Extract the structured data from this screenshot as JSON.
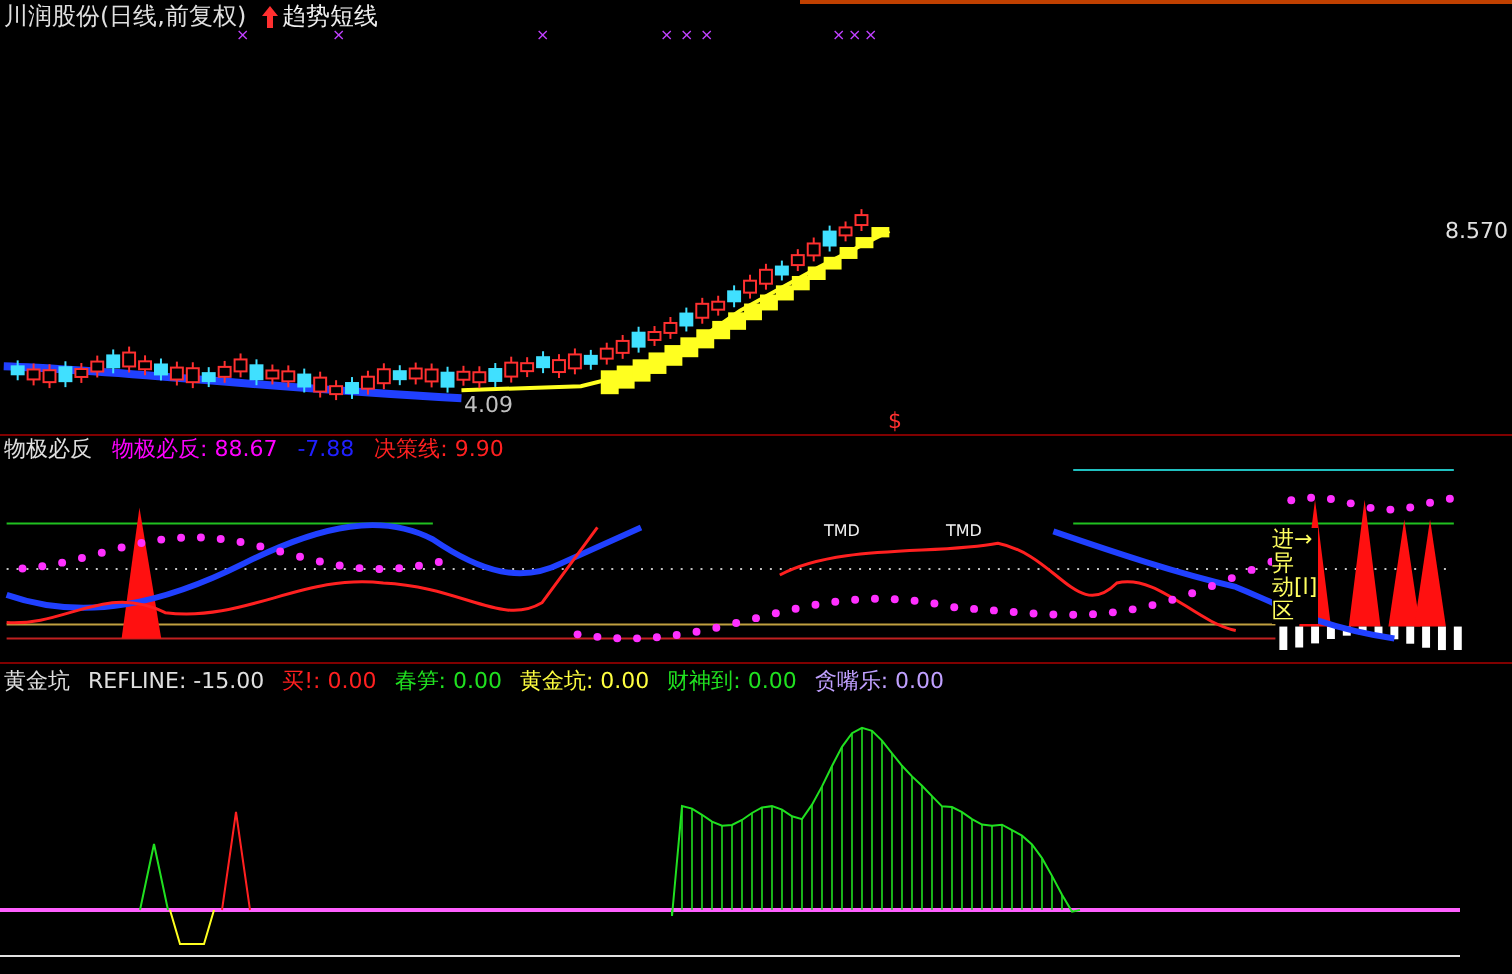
{
  "title": "川润股份(日线,前复权)",
  "indicator": "趋势短线",
  "price_labels": [
    {
      "kind": "low",
      "text": "4.09"
    },
    {
      "kind": "high",
      "text": "8.570"
    }
  ],
  "signal_mark": "$",
  "markers": [
    "×",
    "×",
    "×",
    "×",
    "×",
    "×",
    "×",
    "×",
    "×"
  ],
  "panel_2": {
    "name": "物极必反",
    "values": [
      {
        "label": "物极必反: 88.67",
        "color": "#ff00ff"
      },
      {
        "label": "-7.88",
        "color": "#2020ff"
      },
      {
        "label": "决策线: 9.90",
        "color": "#ff2020"
      }
    ],
    "tags": [
      "TMD",
      "TMD"
    ],
    "side_label": [
      "进→",
      "异",
      "动[l]",
      "区"
    ]
  },
  "panel_3": {
    "name": "黄金坑",
    "refline": "REFLINE: -15.00",
    "values": [
      {
        "label": "买!: 0.00",
        "color": "#ff2020"
      },
      {
        "label": "春笋: 0.00",
        "color": "#20e020"
      },
      {
        "label": "黄金坑: 0.00",
        "color": "#ffff40"
      },
      {
        "label": "财神到: 0.00",
        "color": "#20e020"
      },
      {
        "label": "贪嘴乐: 0.00",
        "color": "#c0a0ff"
      }
    ]
  }
}
